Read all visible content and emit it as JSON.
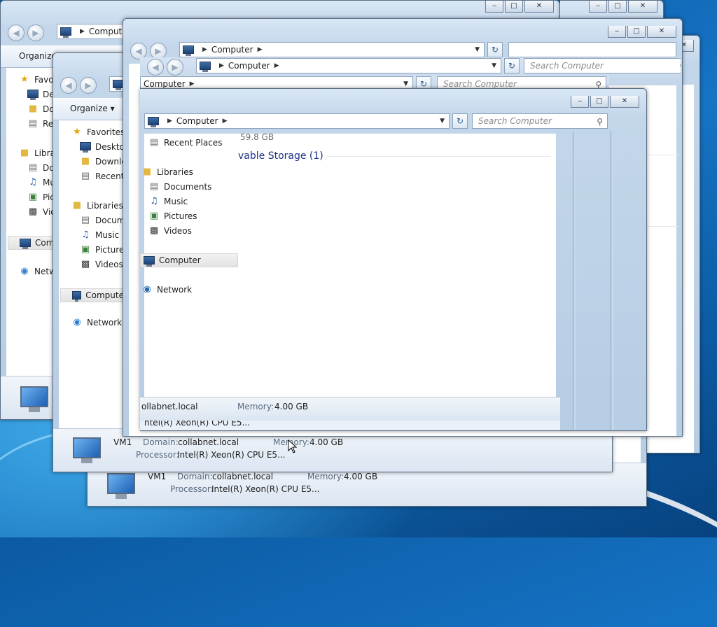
{
  "address": {
    "location": "Computer"
  },
  "search": {
    "placeholder": "Search Computer"
  },
  "toolbar": {
    "organize": "Organize"
  },
  "nav": {
    "favorites": "Favorites",
    "desktop": "Desktop",
    "downloads": "Downloads",
    "recent_places": "Recent Places",
    "libraries": "Libraries",
    "documents": "Documents",
    "music": "Music",
    "pictures": "Pictures",
    "videos": "Videos",
    "computer": "Computer",
    "network": "Network"
  },
  "truncated": {
    "favorites": "Favo",
    "desktop": "Des",
    "downloads": "Dov",
    "recent": "Rec",
    "libraries": "Libra",
    "documents": "Do",
    "music": "Mu",
    "pictures": "Pic",
    "videos": "Vid",
    "computer": "Com",
    "network": "Netw",
    "desktop2": "Desktop",
    "downloads2": "Downlo",
    "recent2": "Recent I",
    "documents2": "Docume",
    "pictures2": "Pictures",
    "computer2": "Compute"
  },
  "main": {
    "free_space": "59.8 GB",
    "removable_heading": "vable Storage (1)"
  },
  "details": {
    "name": "VM1",
    "domain_label": "Domain:",
    "domain": "collabnet.local",
    "domain_cut": "ollabnet.local",
    "memory_label": "Memory:",
    "memory": "4.00 GB",
    "processor_label": "Processor:",
    "processor": "Intel(R) Xeon(R) CPU E5...",
    "processor_cut": "ntel(R) Xeon(R) CPU E5..."
  },
  "caption": {
    "minimize": "‒",
    "maximize": "□",
    "close": "✕"
  },
  "colors": {
    "accent": "#1674c5",
    "window_frame": "#c3d6ea",
    "selection": "#e3e3e3"
  }
}
